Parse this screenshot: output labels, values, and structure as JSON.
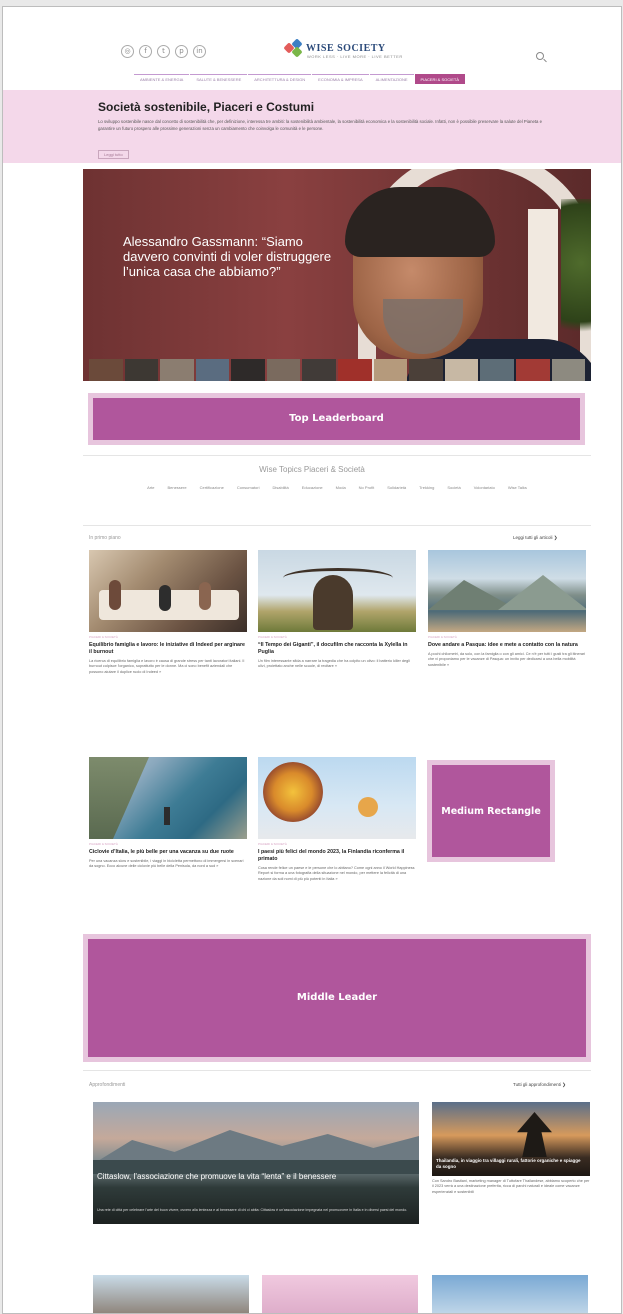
{
  "header": {
    "social_icons": [
      "instagram-icon",
      "facebook-icon",
      "twitter-icon",
      "pinterest-icon",
      "linkedin-icon"
    ],
    "social_glyphs": [
      "◎",
      "f",
      "t",
      "p",
      "in"
    ],
    "logo_text": "WISE SOCIETY",
    "logo_tagline": "WORK LESS · LIVE MORE · LIVE BETTER",
    "search_icon": "search-icon"
  },
  "nav": {
    "items": [
      "Ambiente & Energia",
      "Salute & Benessere",
      "Architettura & Design",
      "Economia & Impresa",
      "Alimentazione",
      "Piaceri & Società"
    ],
    "active_index": 5
  },
  "intro": {
    "title": "Società sostenibile, Piaceri e Costumi",
    "text": "Lo sviluppo sostenibile nasce dal concetto di sostenibilità che, per definizione, interessa tre ambiti: la sostenibilità ambientale, la sostenibilità economica e la sostenibilità sociale. Infatti, non è possibile preservare la salute del Pianeta e garantire un futuro prospero alle prossime generazioni senza un cambiamento che coinvolga le comunità e le persone.",
    "more_label": "Leggi tutto"
  },
  "hero": {
    "title": "Alessandro Gassmann: “Siamo davvero convinti di voler distruggere l’unica casa che abbiamo?”"
  },
  "ads": {
    "top": "Top Leaderboard",
    "medium": "Medium Rectangle",
    "middle": "Middle Leader"
  },
  "topics": {
    "title": "Wise Topics Piaceri & Società",
    "items": [
      "Arte",
      "Benessere",
      "Certificazione",
      "Consumatori",
      "Disabilità",
      "Educazione",
      "Moda",
      "No Profit",
      "Solidarietà",
      "Trekking",
      "Società",
      "Volontariato",
      "Wise Talks"
    ]
  },
  "in_primo_piano": {
    "heading": "In primo piano",
    "link": "Leggi tutti gli articoli",
    "cards": [
      {
        "category": "Piaceri & Società",
        "title": "Equilibrio famiglia e lavoro: le iniziative di Indeed per arginare il burnout",
        "excerpt": "La ricerca di equilibrio famiglia e lavoro è causa di grande stress per tanti lavoratori italiani. Il burnout colpisce l'organico, soprattutto per le donne. Ma ci sono benefit aziendali che possono aiutare il duplice ruolo di Indeed »"
      },
      {
        "category": "Piaceri & Società",
        "title": "“Il Tempo dei Giganti”, il docufilm che racconta la Xylella in Puglia",
        "excerpt": "Un film interessante sfida a narrare la tragedia che ha colpito un olivo: il batterio killer degli ulivi, proiettato anche nelle scuole, di recitare »"
      },
      {
        "category": "Piaceri & Società",
        "title": "Dove andare a Pasqua: idee e mete a contatto con la natura",
        "excerpt": "A pochi chilometri, da solo, con la famiglia o con gli amici. Ce n'è per tutti i gusti tra gli itinerari che vi proponiamo per le vacanze di Pasqua: un invito per dedicarsi a una bella mobilità sostenibile »"
      },
      {
        "category": "Piaceri & Società",
        "title": "Ciclovie d’Italia, le più belle per una vacanza su due ruote",
        "excerpt": "Per una vacanza slow e sostenibile, i viaggi in bicicletta permettono di immergersi in scenari da sogno. Ecco alcune delle ciclovie più belle della Penisola, da nord a sud »"
      },
      {
        "category": "Piaceri & Società",
        "title": "I paesi più felici del mondo 2023, la Finlandia riconferma il primato",
        "excerpt": "Cosa rende felice un paese e le persone che lo abitano? Come ogni anno il World Happiness Report si forma a una fotografia della situazione nel mondo, per mettere la felicità di una nazione da soli nomi di più più potenti in Italia »"
      }
    ]
  },
  "approfondimenti": {
    "heading": "Approfondimenti",
    "link": "Tutti gli approfondimenti",
    "big": {
      "title": "Cittaslow, l’associazione che promuove la vita “lenta” e il benessere",
      "excerpt": "Una rete di città per celebrare l'arte del buon vivere, ovvero alla lentezza e al benessere di chi ci abita: Cittaslow è un'associazione impegnata nel promuovere in Italia e in diversi paesi del mondo."
    },
    "side": {
      "title": "Thailandia, in viaggio tra villaggi rurali, fattorie organiche e spiagge da sogno",
      "excerpt": "Con Sandro Bastiani, marketing manager di Tuttofare Thailandese, abbiamo scoperto che per il 2023 verrà a una destinazione preferita, ricca di parchi naturali e ideale come vacanze esperienziali e sostenibili"
    }
  }
}
